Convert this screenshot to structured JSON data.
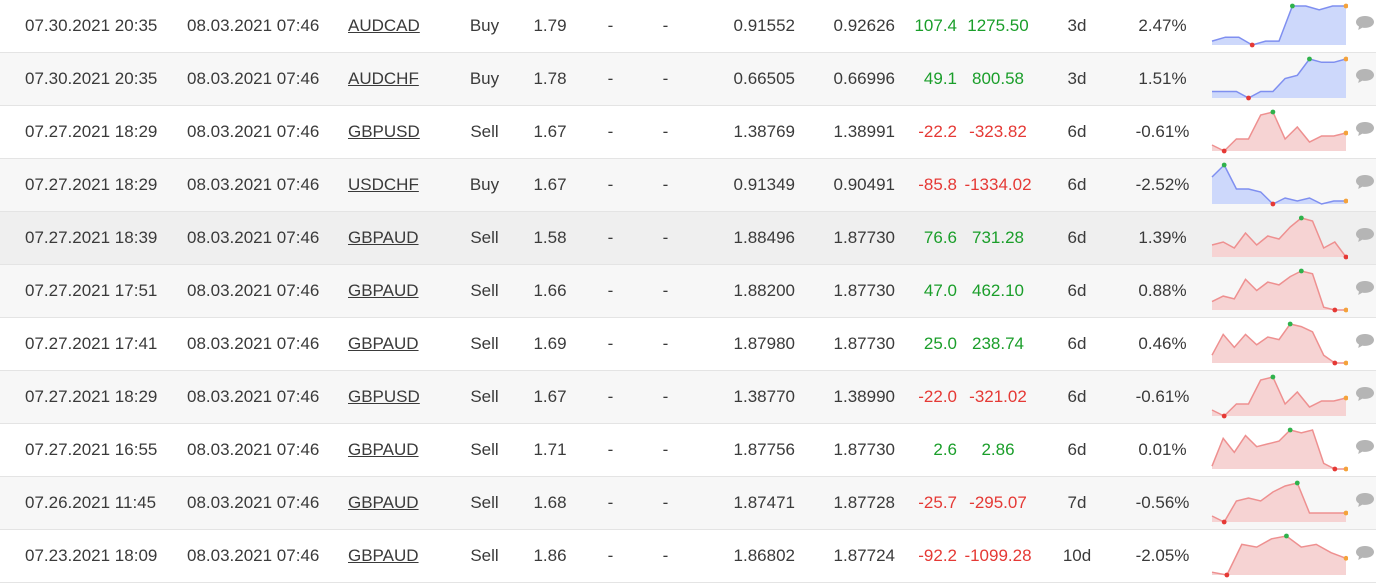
{
  "colors": {
    "positive": "#1a9e2a",
    "negative": "#e53935",
    "buy_line": "#7f8ff0",
    "buy_fill": "#cdd8fb",
    "sell_line": "#ee9090",
    "sell_fill": "#f6d3d3",
    "marker_max": "#2fb24c",
    "marker_min": "#e53935",
    "marker_last": "#f4a23b",
    "comment_icon": "#b5b5b5"
  },
  "comment_icon": "speech-bubble-icon",
  "trades": [
    {
      "open_time": "07.30.2021 20:35",
      "close_time": "08.03.2021 07:46",
      "symbol": "AUDCAD",
      "type": "Buy",
      "lots": "1.79",
      "sl": "-",
      "tp": "-",
      "open_price": "0.91552",
      "close_price": "0.92626",
      "pips": "107.4",
      "profit": "1275.50",
      "duration": "3d",
      "gain": "2.47%",
      "sign": "pos",
      "spark": [
        3,
        4,
        4,
        2,
        3,
        3,
        12,
        12,
        11,
        12,
        12
      ]
    },
    {
      "open_time": "07.30.2021 20:35",
      "close_time": "08.03.2021 07:46",
      "symbol": "AUDCHF",
      "type": "Buy",
      "lots": "1.78",
      "sl": "-",
      "tp": "-",
      "open_price": "0.66505",
      "close_price": "0.66996",
      "pips": "49.1",
      "profit": "800.58",
      "duration": "3d",
      "gain": "1.51%",
      "sign": "pos",
      "spark": [
        3,
        3,
        3,
        1,
        3,
        3,
        7,
        8,
        13,
        12,
        12,
        13
      ]
    },
    {
      "open_time": "07.27.2021 18:29",
      "close_time": "08.03.2021 07:46",
      "symbol": "GBPUSD",
      "type": "Sell",
      "lots": "1.67",
      "sl": "-",
      "tp": "-",
      "open_price": "1.38769",
      "close_price": "1.38991",
      "pips": "-22.2",
      "profit": "-323.82",
      "duration": "6d",
      "gain": "-0.61%",
      "sign": "neg",
      "spark": [
        4,
        2,
        6,
        6,
        14,
        15,
        6,
        10,
        5,
        7,
        7,
        8
      ]
    },
    {
      "open_time": "07.27.2021 18:29",
      "close_time": "08.03.2021 07:46",
      "symbol": "USDCHF",
      "type": "Buy",
      "lots": "1.67",
      "sl": "-",
      "tp": "-",
      "open_price": "0.91349",
      "close_price": "0.90491",
      "pips": "-85.8",
      "profit": "-1334.02",
      "duration": "6d",
      "gain": "-2.52%",
      "sign": "neg",
      "spark": [
        10,
        14,
        6,
        6,
        5,
        1,
        3,
        2,
        3,
        1,
        2,
        2
      ]
    },
    {
      "open_time": "07.27.2021 18:39",
      "close_time": "08.03.2021 07:46",
      "symbol": "GBPAUD",
      "type": "Sell",
      "lots": "1.58",
      "sl": "-",
      "tp": "-",
      "open_price": "1.88496",
      "close_price": "1.87730",
      "pips": "76.6",
      "profit": "731.28",
      "duration": "6d",
      "gain": "1.39%",
      "sign": "pos",
      "spark": [
        6,
        7,
        5,
        10,
        6,
        9,
        8,
        12,
        15,
        14,
        5,
        7,
        2
      ]
    },
    {
      "open_time": "07.27.2021 17:51",
      "close_time": "08.03.2021 07:46",
      "symbol": "GBPAUD",
      "type": "Sell",
      "lots": "1.66",
      "sl": "-",
      "tp": "-",
      "open_price": "1.88200",
      "close_price": "1.87730",
      "pips": "47.0",
      "profit": "462.10",
      "duration": "6d",
      "gain": "0.88%",
      "sign": "pos",
      "spark": [
        4,
        6,
        5,
        12,
        8,
        11,
        10,
        13,
        15,
        14,
        2,
        1,
        1
      ]
    },
    {
      "open_time": "07.27.2021 17:41",
      "close_time": "08.03.2021 07:46",
      "symbol": "GBPAUD",
      "type": "Sell",
      "lots": "1.69",
      "sl": "-",
      "tp": "-",
      "open_price": "1.87980",
      "close_price": "1.87730",
      "pips": "25.0",
      "profit": "238.74",
      "duration": "6d",
      "gain": "0.46%",
      "sign": "pos",
      "spark": [
        4,
        12,
        7,
        12,
        8,
        11,
        10,
        16,
        15,
        13,
        4,
        1,
        1
      ]
    },
    {
      "open_time": "07.27.2021 18:29",
      "close_time": "08.03.2021 07:46",
      "symbol": "GBPUSD",
      "type": "Sell",
      "lots": "1.67",
      "sl": "-",
      "tp": "-",
      "open_price": "1.38770",
      "close_price": "1.38990",
      "pips": "-22.0",
      "profit": "-321.02",
      "duration": "6d",
      "gain": "-0.61%",
      "sign": "neg",
      "spark": [
        4,
        2,
        6,
        6,
        14,
        15,
        6,
        10,
        5,
        7,
        7,
        8
      ]
    },
    {
      "open_time": "07.27.2021 16:55",
      "close_time": "08.03.2021 07:46",
      "symbol": "GBPAUD",
      "type": "Sell",
      "lots": "1.71",
      "sl": "-",
      "tp": "-",
      "open_price": "1.87756",
      "close_price": "1.87730",
      "pips": "2.6",
      "profit": "2.86",
      "duration": "6d",
      "gain": "0.01%",
      "sign": "pos",
      "spark": [
        2,
        12,
        7,
        13,
        9,
        10,
        11,
        15,
        14,
        15,
        3,
        1,
        1
      ]
    },
    {
      "open_time": "07.26.2021 11:45",
      "close_time": "08.03.2021 07:46",
      "symbol": "GBPAUD",
      "type": "Sell",
      "lots": "1.68",
      "sl": "-",
      "tp": "-",
      "open_price": "1.87471",
      "close_price": "1.87728",
      "pips": "-25.7",
      "profit": "-295.07",
      "duration": "7d",
      "gain": "-0.56%",
      "sign": "neg",
      "spark": [
        3,
        1,
        8,
        9,
        8,
        11,
        13,
        14,
        4,
        4,
        4,
        4
      ]
    },
    {
      "open_time": "07.23.2021 18:09",
      "close_time": "08.03.2021 07:46",
      "symbol": "GBPAUD",
      "type": "Sell",
      "lots": "1.86",
      "sl": "-",
      "tp": "-",
      "open_price": "1.86802",
      "close_price": "1.87724",
      "pips": "-92.2",
      "profit": "-1099.28",
      "duration": "10d",
      "gain": "-2.05%",
      "sign": "neg",
      "spark": [
        2,
        1,
        12,
        11,
        14,
        15,
        11,
        12,
        9,
        7
      ]
    }
  ]
}
